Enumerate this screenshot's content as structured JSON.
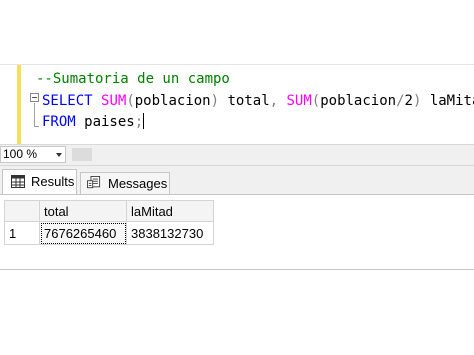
{
  "editor": {
    "line1_comment": "--Sumatoria de un campo",
    "line2": {
      "kw_select": "SELECT",
      "fn_sum1": "SUM",
      "paren_open1": "(",
      "col1": "poblacion",
      "paren_close1": ")",
      "alias1": " total",
      "comma": ",",
      "fn_sum2": " SUM",
      "paren_open2": "(",
      "col2": "poblacion",
      "op_div": "/",
      "num2": "2",
      "paren_close2": ")",
      "alias2": " laMitad"
    },
    "line3": {
      "kw_from": "FROM",
      "table": " paises",
      "semicolon": ";"
    }
  },
  "zoom": {
    "value": "100 %"
  },
  "tabs": {
    "results_label": "Results",
    "messages_label": "Messages"
  },
  "grid": {
    "columns": [
      "total",
      "laMitad"
    ],
    "rows": [
      {
        "rownum": "1",
        "total": "7676265460",
        "laMitad": "3838132730"
      }
    ]
  },
  "colors": {
    "keyword": "#0000ff",
    "function": "#ff00ff",
    "comment": "#008000",
    "operator": "#808080",
    "margin_bar": "#f2e05a"
  }
}
